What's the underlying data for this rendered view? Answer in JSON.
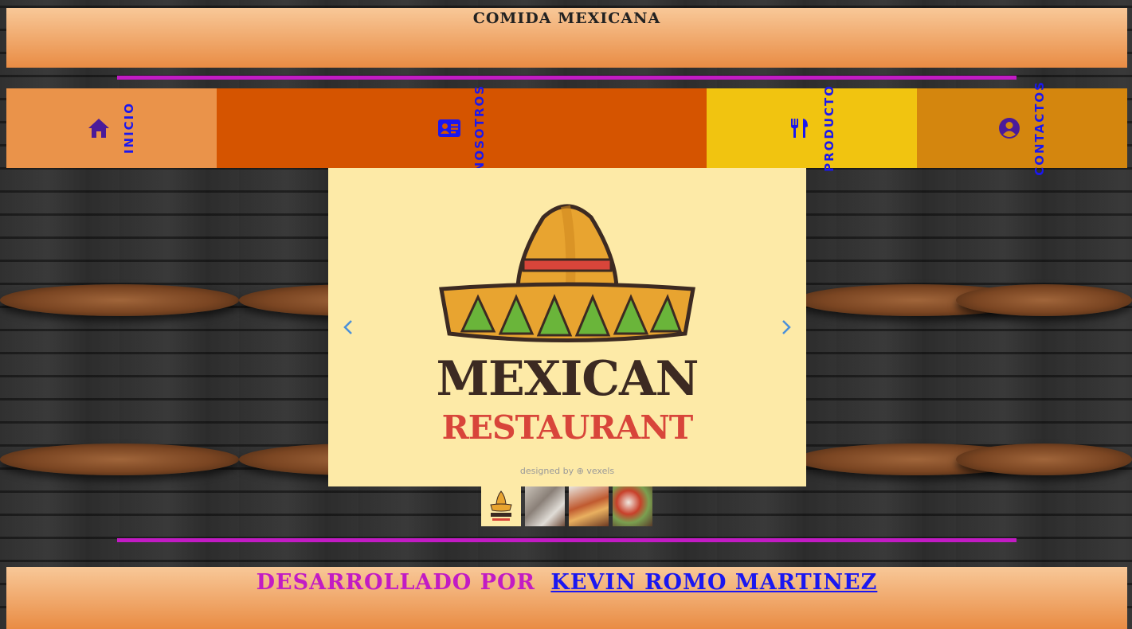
{
  "header": {
    "title": "COMIDA MEXICANA"
  },
  "nav": {
    "items": [
      {
        "label": "INICIO",
        "icon": "home-icon",
        "background": "#ea934a"
      },
      {
        "label": "NOSOTROS",
        "icon": "id-card-icon",
        "background": "#d55400"
      },
      {
        "label": "PRODUCTO",
        "icon": "utensils-icon",
        "background": "#f1c410"
      },
      {
        "label": "CONTACTOS",
        "icon": "user-circle-icon",
        "background": "#d4860e"
      }
    ]
  },
  "carousel": {
    "logo_line_1": "MEXICAN",
    "logo_line_2": "RESTAURANT",
    "credit": "designed by ⊕ vexels",
    "thumbnails": [
      "logo-thumbnail",
      "food-photo-1",
      "food-photo-2",
      "food-photo-3"
    ]
  },
  "footer": {
    "prefix": "DESARROLLADO POR",
    "author": "KEVIN ROMO MARTINEZ"
  },
  "colors": {
    "accent_magenta": "#c21bc4",
    "link_blue": "#1a17f0",
    "icon_purple": "#4a1a9a",
    "header_gradient_top": "#f8c898",
    "header_gradient_bottom": "#e98c44"
  }
}
